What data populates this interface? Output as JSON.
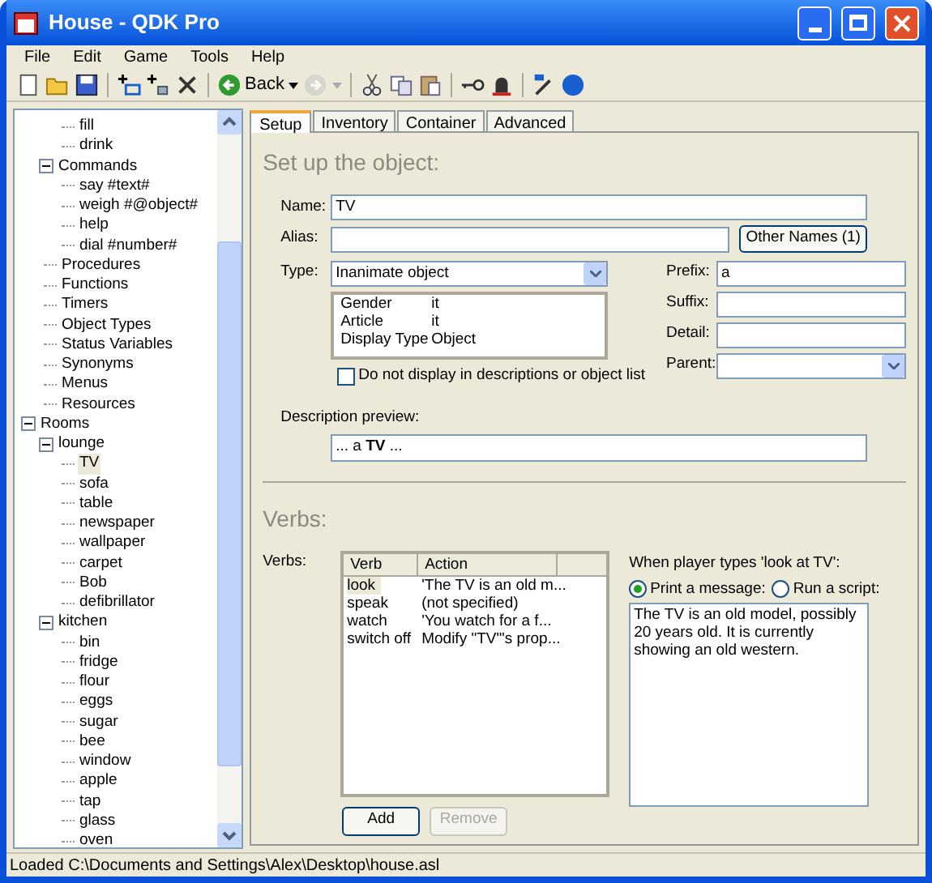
{
  "window": {
    "title": "House - QDK Pro"
  },
  "menu": [
    "File",
    "Edit",
    "Game",
    "Tools",
    "Help"
  ],
  "toolbar": [
    {
      "kind": "new"
    },
    {
      "kind": "open"
    },
    {
      "kind": "save"
    },
    {
      "kind": "sep"
    },
    {
      "kind": "add-room"
    },
    {
      "kind": "add-object"
    },
    {
      "kind": "delete"
    },
    {
      "kind": "sep"
    },
    {
      "kind": "back",
      "label": "Back",
      "disabled": false
    },
    {
      "kind": "caret",
      "disabled": false
    },
    {
      "kind": "forward",
      "disabled": true
    },
    {
      "kind": "caret",
      "disabled": true
    },
    {
      "kind": "sep"
    },
    {
      "kind": "cut"
    },
    {
      "kind": "copy"
    },
    {
      "kind": "paste"
    },
    {
      "kind": "sep"
    },
    {
      "kind": "key"
    },
    {
      "kind": "bell"
    },
    {
      "kind": "sep"
    },
    {
      "kind": "wand"
    },
    {
      "kind": "help"
    }
  ],
  "tree": [
    {
      "children": [
        {
          "children": [
            {
              "label": "fill",
              "selected": false
            },
            {
              "label": "drink",
              "selected": false
            }
          ]
        },
        {
          "label": "Commands",
          "expanded": true,
          "selected": false,
          "children": [
            {
              "label": "say #text#",
              "selected": false
            },
            {
              "label": "weigh #@object#",
              "selected": false
            },
            {
              "label": "help",
              "selected": false
            },
            {
              "label": "dial #number#",
              "selected": false
            }
          ]
        },
        {
          "label": "Procedures",
          "selected": false
        },
        {
          "label": "Functions",
          "selected": false
        },
        {
          "label": "Timers",
          "selected": false
        },
        {
          "label": "Object Types",
          "selected": false
        },
        {
          "label": "Status Variables",
          "selected": false
        },
        {
          "label": "Synonyms",
          "selected": false
        },
        {
          "label": "Menus",
          "selected": false
        },
        {
          "label": "Resources",
          "selected": false
        }
      ]
    },
    {
      "label": "Rooms",
      "expanded": true,
      "selected": false,
      "children": [
        {
          "label": "lounge",
          "expanded": true,
          "selected": false,
          "children": [
            {
              "label": "TV",
              "selected": true
            },
            {
              "label": "sofa",
              "selected": false
            },
            {
              "label": "table",
              "selected": false
            },
            {
              "label": "newspaper",
              "selected": false
            },
            {
              "label": "wallpaper",
              "selected": false
            },
            {
              "label": "carpet",
              "selected": false
            },
            {
              "label": "Bob",
              "selected": false
            },
            {
              "label": "defibrillator",
              "selected": false
            }
          ]
        },
        {
          "label": "kitchen",
          "expanded": true,
          "selected": false,
          "children": [
            {
              "label": "bin",
              "selected": false
            },
            {
              "label": "fridge",
              "selected": false
            },
            {
              "label": "flour",
              "selected": false
            },
            {
              "label": "eggs",
              "selected": false
            },
            {
              "label": "sugar",
              "selected": false
            },
            {
              "label": "bee",
              "selected": false
            },
            {
              "label": "window",
              "selected": false
            },
            {
              "label": "apple",
              "selected": false
            },
            {
              "label": "tap",
              "selected": false
            },
            {
              "label": "glass",
              "selected": false
            },
            {
              "label": "oven",
              "selected": false
            }
          ]
        }
      ]
    }
  ],
  "tabs": [
    {
      "label": "Setup",
      "selected": true
    },
    {
      "label": "Inventory",
      "selected": false
    },
    {
      "label": "Container",
      "selected": false
    },
    {
      "label": "Advanced",
      "selected": false
    }
  ],
  "setup": {
    "heading": "Set up the object:",
    "name_label": "Name:",
    "name": "TV",
    "alias_label": "Alias:",
    "other_names": "Other Names (1)",
    "type_label": "Type:",
    "type": "Inanimate object",
    "properties": [
      {
        "key": "Gender",
        "value": "it"
      },
      {
        "key": "Article",
        "value": "it"
      },
      {
        "key": "Display Type",
        "value": "Object"
      }
    ],
    "hide_checkbox": {
      "label": "Do not display in descriptions or object list",
      "checked": false
    },
    "prefix_label": "Prefix:",
    "prefix": "a",
    "suffix_label": "Suffix:",
    "detail_label": "Detail:",
    "parent_label": "Parent:",
    "preview_label": "Description preview:",
    "preview": "... a **TV** ..."
  },
  "verbs": {
    "heading": "Verbs:",
    "label": "Verbs:",
    "columns": [
      "Verb",
      "Action"
    ],
    "rows": [
      {
        "verb": "look",
        "action": "'The TV is an old m...",
        "selected": true
      },
      {
        "verb": "speak",
        "action": "(not specified)",
        "selected": false
      },
      {
        "verb": "watch",
        "action": "'You watch for a f...",
        "selected": false
      },
      {
        "verb": "switch off",
        "action": "Modify \"TV\"'s prop...",
        "selected": false
      }
    ],
    "add": "Add",
    "remove": {
      "label": "Remove",
      "disabled": true
    },
    "when_label": "When player types 'look at TV':",
    "options": [
      {
        "label": "Print a message:",
        "selected": true
      },
      {
        "label": "Run a script:",
        "selected": false
      }
    ],
    "message": "The TV is an old model, possibly 20 years old. It is currently showing an old western."
  },
  "status_bar": "Loaded C:\\Documents and Settings\\Alex\\Desktop\\house.asl"
}
